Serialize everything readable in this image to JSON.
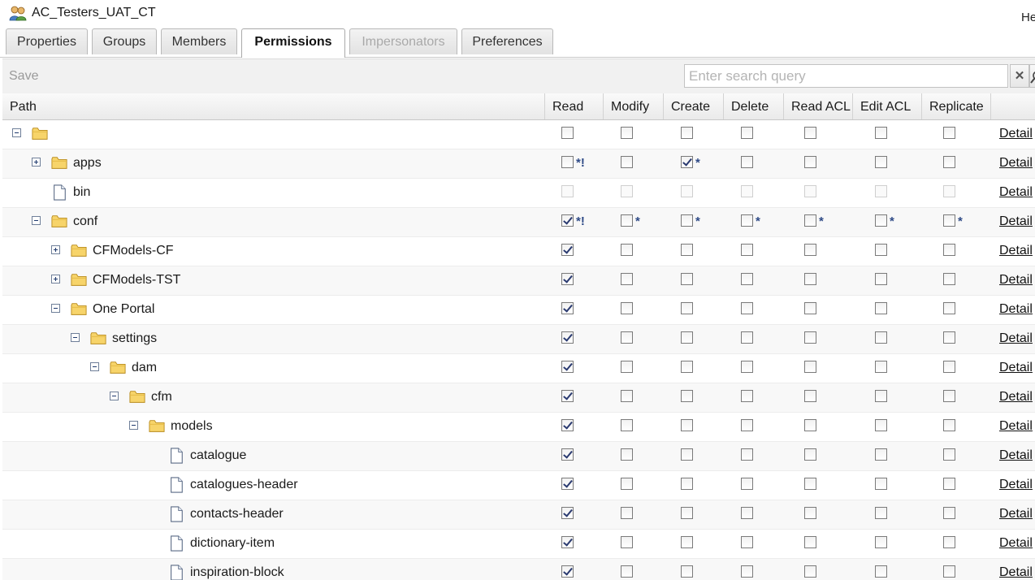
{
  "window": {
    "title": "AC_Testers_UAT_CT",
    "help_partial": "He"
  },
  "tabs": [
    {
      "label": "Properties",
      "state": "normal"
    },
    {
      "label": "Groups",
      "state": "normal"
    },
    {
      "label": "Members",
      "state": "normal"
    },
    {
      "label": "Permissions",
      "state": "active"
    },
    {
      "label": "Impersonators",
      "state": "disabled"
    },
    {
      "label": "Preferences",
      "state": "normal"
    }
  ],
  "toolbar": {
    "save_label": "Save",
    "search_placeholder": "Enter search query",
    "search_value": "",
    "clear_symbol": "✕"
  },
  "grid": {
    "columns": [
      "Path",
      "Read",
      "Modify",
      "Create",
      "Delete",
      "Read ACL",
      "Edit ACL",
      "Replicate"
    ],
    "detail_label": "Detail",
    "rows": [
      {
        "label": "",
        "depth": 0,
        "icon": "folder-icon",
        "toggle": "collapse",
        "perms": [
          {
            "c": 0
          },
          {
            "c": 0
          },
          {
            "c": 0
          },
          {
            "c": 0
          },
          {
            "c": 0
          },
          {
            "c": 0
          },
          {
            "c": 0
          }
        ]
      },
      {
        "label": "apps",
        "depth": 1,
        "icon": "folder-icon",
        "toggle": "expand",
        "perms": [
          {
            "c": 0,
            "m": "*!"
          },
          {
            "c": 0
          },
          {
            "c": 1,
            "m": "*"
          },
          {
            "c": 0
          },
          {
            "c": 0
          },
          {
            "c": 0
          },
          {
            "c": 0
          }
        ]
      },
      {
        "label": "bin",
        "depth": 1,
        "icon": "file-icon",
        "toggle": "none",
        "perms": [
          {
            "c": 0,
            "d": 1
          },
          {
            "c": 0,
            "d": 1
          },
          {
            "c": 0,
            "d": 1
          },
          {
            "c": 0,
            "d": 1
          },
          {
            "c": 0,
            "d": 1
          },
          {
            "c": 0,
            "d": 1
          },
          {
            "c": 0,
            "d": 1
          }
        ]
      },
      {
        "label": "conf",
        "depth": 1,
        "icon": "folder-icon",
        "toggle": "collapse",
        "perms": [
          {
            "c": 1,
            "m": "*!"
          },
          {
            "c": 0,
            "m": "*"
          },
          {
            "c": 0,
            "m": "*"
          },
          {
            "c": 0,
            "m": "*"
          },
          {
            "c": 0,
            "m": "*"
          },
          {
            "c": 0,
            "m": "*"
          },
          {
            "c": 0,
            "m": "*"
          }
        ]
      },
      {
        "label": "CFModels-CF",
        "depth": 2,
        "icon": "folder-icon",
        "toggle": "expand",
        "perms": [
          {
            "c": 1
          },
          {
            "c": 0
          },
          {
            "c": 0
          },
          {
            "c": 0
          },
          {
            "c": 0
          },
          {
            "c": 0
          },
          {
            "c": 0
          }
        ]
      },
      {
        "label": "CFModels-TST",
        "depth": 2,
        "icon": "folder-icon",
        "toggle": "expand",
        "perms": [
          {
            "c": 1
          },
          {
            "c": 0
          },
          {
            "c": 0
          },
          {
            "c": 0
          },
          {
            "c": 0
          },
          {
            "c": 0
          },
          {
            "c": 0
          }
        ]
      },
      {
        "label": "One Portal",
        "depth": 2,
        "icon": "folder-icon",
        "toggle": "collapse",
        "perms": [
          {
            "c": 1
          },
          {
            "c": 0
          },
          {
            "c": 0
          },
          {
            "c": 0
          },
          {
            "c": 0
          },
          {
            "c": 0
          },
          {
            "c": 0
          }
        ]
      },
      {
        "label": "settings",
        "depth": 3,
        "icon": "folder-icon",
        "toggle": "collapse",
        "perms": [
          {
            "c": 1
          },
          {
            "c": 0
          },
          {
            "c": 0
          },
          {
            "c": 0
          },
          {
            "c": 0
          },
          {
            "c": 0
          },
          {
            "c": 0
          }
        ]
      },
      {
        "label": "dam",
        "depth": 4,
        "icon": "folder-icon",
        "toggle": "collapse",
        "perms": [
          {
            "c": 1
          },
          {
            "c": 0
          },
          {
            "c": 0
          },
          {
            "c": 0
          },
          {
            "c": 0
          },
          {
            "c": 0
          },
          {
            "c": 0
          }
        ]
      },
      {
        "label": "cfm",
        "depth": 5,
        "icon": "folder-icon",
        "toggle": "collapse",
        "perms": [
          {
            "c": 1
          },
          {
            "c": 0
          },
          {
            "c": 0
          },
          {
            "c": 0
          },
          {
            "c": 0
          },
          {
            "c": 0
          },
          {
            "c": 0
          }
        ]
      },
      {
        "label": "models",
        "depth": 6,
        "icon": "folder-icon",
        "toggle": "collapse",
        "perms": [
          {
            "c": 1
          },
          {
            "c": 0
          },
          {
            "c": 0
          },
          {
            "c": 0
          },
          {
            "c": 0
          },
          {
            "c": 0
          },
          {
            "c": 0
          }
        ]
      },
      {
        "label": "catalogue",
        "depth": 7,
        "icon": "file-icon",
        "toggle": "none",
        "perms": [
          {
            "c": 1
          },
          {
            "c": 0
          },
          {
            "c": 0
          },
          {
            "c": 0
          },
          {
            "c": 0
          },
          {
            "c": 0
          },
          {
            "c": 0
          }
        ]
      },
      {
        "label": "catalogues-header",
        "depth": 7,
        "icon": "file-icon",
        "toggle": "none",
        "perms": [
          {
            "c": 1
          },
          {
            "c": 0
          },
          {
            "c": 0
          },
          {
            "c": 0
          },
          {
            "c": 0
          },
          {
            "c": 0
          },
          {
            "c": 0
          }
        ]
      },
      {
        "label": "contacts-header",
        "depth": 7,
        "icon": "file-icon",
        "toggle": "none",
        "perms": [
          {
            "c": 1
          },
          {
            "c": 0
          },
          {
            "c": 0
          },
          {
            "c": 0
          },
          {
            "c": 0
          },
          {
            "c": 0
          },
          {
            "c": 0
          }
        ]
      },
      {
        "label": "dictionary-item",
        "depth": 7,
        "icon": "file-icon",
        "toggle": "none",
        "perms": [
          {
            "c": 1
          },
          {
            "c": 0
          },
          {
            "c": 0
          },
          {
            "c": 0
          },
          {
            "c": 0
          },
          {
            "c": 0
          },
          {
            "c": 0
          }
        ]
      },
      {
        "label": "inspiration-block",
        "depth": 7,
        "icon": "file-icon",
        "toggle": "none",
        "perms": [
          {
            "c": 1
          },
          {
            "c": 0
          },
          {
            "c": 0
          },
          {
            "c": 0
          },
          {
            "c": 0
          },
          {
            "c": 0
          },
          {
            "c": 0
          }
        ]
      }
    ]
  }
}
